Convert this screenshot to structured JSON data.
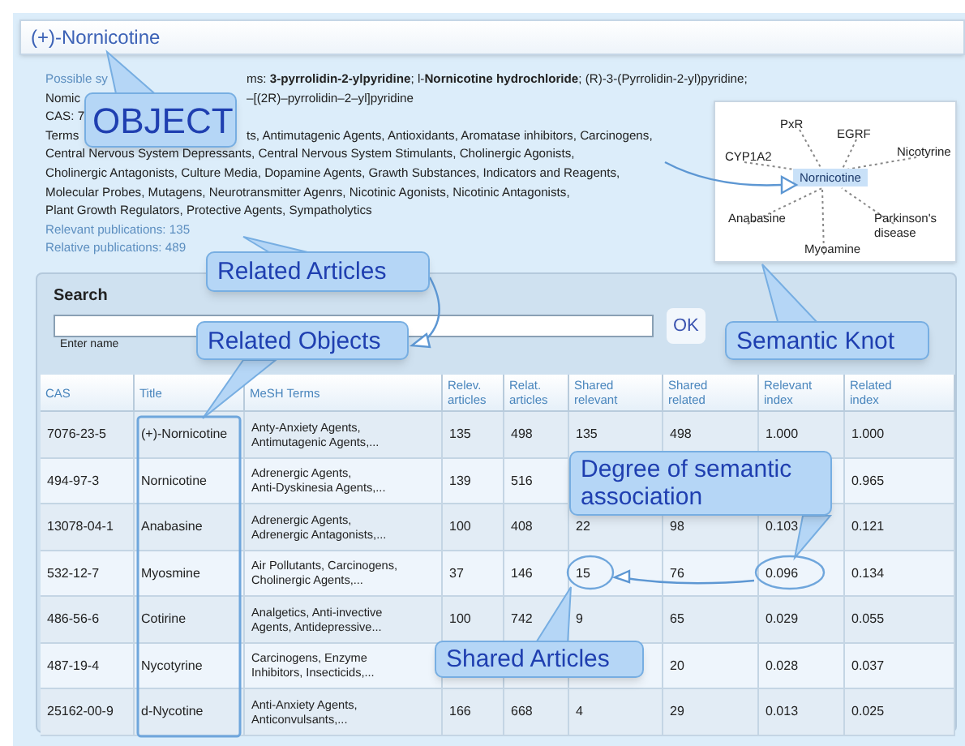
{
  "title": "(+)-Nornicotine",
  "info_lines": [
    {
      "kind": "split",
      "parts": [
        {
          "text": "Possible sy",
          "kind": "label"
        },
        {
          "text": "ms: **3-pyrrolidin-2-ylpyridine**; l-**Nornicotine hydrochloride**; (R)-3-(Pyrrolidin-2-yl)pyridine;",
          "kind": "value"
        }
      ]
    },
    {
      "kind": "split",
      "parts": [
        {
          "text": "Nomic",
          "kind": "value"
        },
        {
          "text": "–[(2R)–pyrrolidin–2–yl]pyridine",
          "kind": "value"
        }
      ]
    },
    {
      "kind": "plain",
      "parts": [
        {
          "text": "CAS: 7",
          "kind": "value"
        }
      ]
    },
    {
      "kind": "split",
      "parts": [
        {
          "text": "Terms",
          "kind": "value"
        },
        {
          "text": "ts, Antimutagenic Agents, Antioxidants, Aromatase inhibitors, Carcinogens,",
          "kind": "value"
        }
      ]
    },
    {
      "kind": "plain",
      "parts": [
        {
          "text": "Central Nervous System Depressants, Central Nervous System Stimulants, Cholinergic Agonists,",
          "kind": "value"
        }
      ]
    },
    {
      "kind": "plain",
      "parts": [
        {
          "text": "Cholinergic Antagonists, Culture Media, Dopamine Agents, Grawth Substances, Indicators and Reagents,",
          "kind": "value"
        }
      ]
    },
    {
      "kind": "plain",
      "parts": [
        {
          "text": "Molecular Probes, Mutagens, Neurotransmitter Agenrs, Nicotinic Agonists, Nicotinic Antagonists,",
          "kind": "value"
        }
      ]
    },
    {
      "kind": "plain",
      "parts": [
        {
          "text": "Plant Growth Regulators, Protective Agents, Sympatholytics",
          "kind": "value"
        }
      ]
    },
    {
      "kind": "plain",
      "parts": [
        {
          "text": "Relevant publications: 135",
          "kind": "label"
        }
      ]
    },
    {
      "kind": "plain",
      "parts": [
        {
          "text": "Relative publications: 489",
          "kind": "label"
        }
      ]
    }
  ],
  "knot": {
    "nodes": [
      {
        "label": "PxR",
        "kind": "node"
      },
      {
        "label": "EGRF",
        "kind": "node"
      },
      {
        "label": "CYP1A2",
        "kind": "node"
      },
      {
        "label": "Nicotyrine",
        "kind": "node"
      },
      {
        "label": "Nornicotine",
        "kind": "center"
      },
      {
        "label": "Anabasine",
        "kind": "node"
      },
      {
        "label": "Myoamine",
        "kind": "node"
      },
      {
        "label": "Parkinson's\ndisease",
        "kind": "node"
      }
    ]
  },
  "search": {
    "label": "Search",
    "hint": "Enter name",
    "button": "OK"
  },
  "table": {
    "columns": [
      "CAS",
      "Title",
      "MeSH Terms",
      "Relev.\narticles",
      "Relat.\narticles",
      "Shared\nrelevant",
      "Shared\nrelated",
      "Relevant\nindex",
      "Related\nindex"
    ],
    "rows": [
      [
        "7076-23-5",
        "(+)-Nornicotine",
        "Anty-Anxiety Agents,\nAntimutagenic Agents,...",
        "135",
        "498",
        "135",
        "498",
        "1.000",
        "1.000"
      ],
      [
        "494-97-3",
        "Nornicotine",
        "Adrenergic Agents,\nAnti-Dyskinesia Agents,...",
        "139",
        "516",
        null,
        null,
        null,
        "0.965"
      ],
      [
        "13078-04-1",
        "Anabasine",
        "Adrenergic Agents,\nAdrenergic Antagonists,...",
        "100",
        "408",
        "22",
        "98",
        "0.103",
        "0.121"
      ],
      [
        "532-12-7",
        "Myosmine",
        "Air Pollutants, Carcinogens,\nCholinergic Agents,...",
        "37",
        "146",
        "15",
        "76",
        "0.096",
        "0.134"
      ],
      [
        "486-56-6",
        "Cotirine",
        "Analgetics, Anti-invective\nAgents, Antidepressive...",
        "100",
        "742",
        "9",
        "65",
        "0.029",
        "0.055"
      ],
      [
        "487-19-4",
        "Nycotyrine",
        "Carcinogens, Enzyme\nInhibitors, Insecticids,...",
        null,
        null,
        null,
        "20",
        "0.028",
        "0.037"
      ],
      [
        "25162-00-9",
        "d-Nycotine",
        "Anti-Anxiety Agents,\nAnticonvulsants,...",
        "166",
        "668",
        "4",
        "29",
        "0.013",
        "0.025"
      ]
    ]
  },
  "callouts": [
    {
      "text": "OBJECT",
      "kind": "big"
    },
    {
      "text": "Related Articles",
      "kind": "normal"
    },
    {
      "text": "Related Objects",
      "kind": "normal"
    },
    {
      "text": "Semantic Knot",
      "kind": "normal"
    },
    {
      "text": "Degree of semantic\nassociation",
      "kind": "normal"
    },
    {
      "text": "Shared Articles",
      "kind": "normal"
    }
  ]
}
